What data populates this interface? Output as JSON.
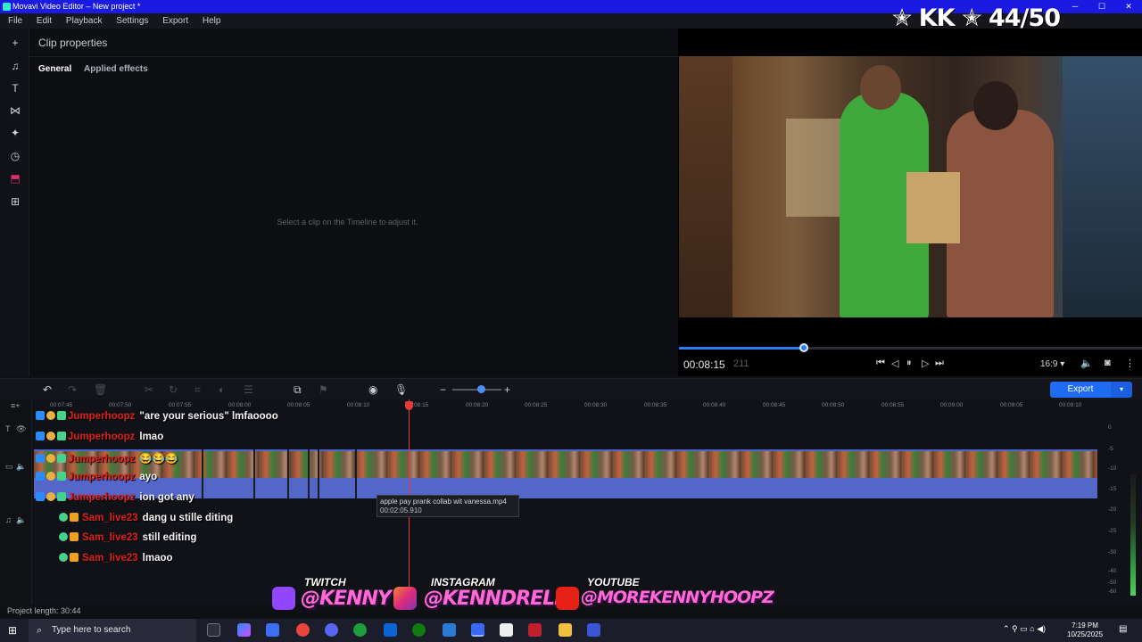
{
  "window": {
    "title": "Movavi Video Editor – New project *"
  },
  "menu": [
    "File",
    "Edit",
    "Playback",
    "Settings",
    "Export",
    "Help"
  ],
  "overlay_rank": "✭ KK ✭ 44/50",
  "properties": {
    "title": "Clip properties",
    "tabs": [
      "General",
      "Applied effects"
    ],
    "hint": "Select a clip on the Timeline to adjust it."
  },
  "player": {
    "timecode": "00:08:15",
    "frames": "211",
    "aspect": "16:9 ▾",
    "progress": 0.27
  },
  "toolbar": {
    "export_label": "Export"
  },
  "ruler": [
    "00:07:45",
    "00:07:50",
    "00:07:55",
    "00:08:00",
    "00:08:05",
    "00:08:10",
    "00:08:15",
    "00:08:20",
    "00:08:25",
    "00:08:30",
    "00:08:35",
    "00:08:40",
    "00:08:45",
    "00:08:50",
    "00:08:55",
    "00:09:00",
    "00:09:05",
    "00:09:10"
  ],
  "clip_tooltip": {
    "name": "apple pay prank collab wit vanessa.mp4",
    "duration": "00:02:05.910"
  },
  "meter_labels": [
    "0",
    "-5",
    "-10",
    "-15",
    "-20",
    "-25",
    "-30",
    "-40",
    "-50",
    "-60"
  ],
  "chat": [
    {
      "user": "Jumperhoopz",
      "msg": "\"are your serious\" lmfaoooo"
    },
    {
      "user": "Jumperhoopz",
      "msg": "lmao"
    },
    {
      "user": "Jumperhoopz",
      "msg": "😂😂😂"
    },
    {
      "user": "Jumperhoopz",
      "msg": "ayo"
    },
    {
      "user": "Jumperhoopz",
      "msg": "ion got any"
    },
    {
      "user": "Sam_live23",
      "msg": "dang u stille diting"
    },
    {
      "user": "Sam_live23",
      "msg": "still editing"
    },
    {
      "user": "Sam_live23",
      "msg": "lmaoo"
    }
  ],
  "socials": [
    {
      "platform": "TWITCH",
      "handle": "@KENNY"
    },
    {
      "platform": "INSTAGRAM",
      "handle": "@KENNDRELL"
    },
    {
      "platform": "YOUTUBE",
      "handle": "@MOREKENNYHOOPZ"
    }
  ],
  "project_length": "Project length: 30:44",
  "taskbar": {
    "search_placeholder": "Type here to search",
    "time": "7:19 PM",
    "date": "10/25/2025"
  },
  "colors": {
    "accent": "#1f6bf2",
    "playhead": "#e23b3b",
    "chat_user": "#e0201c",
    "titlebar": "#1a1ae0"
  }
}
